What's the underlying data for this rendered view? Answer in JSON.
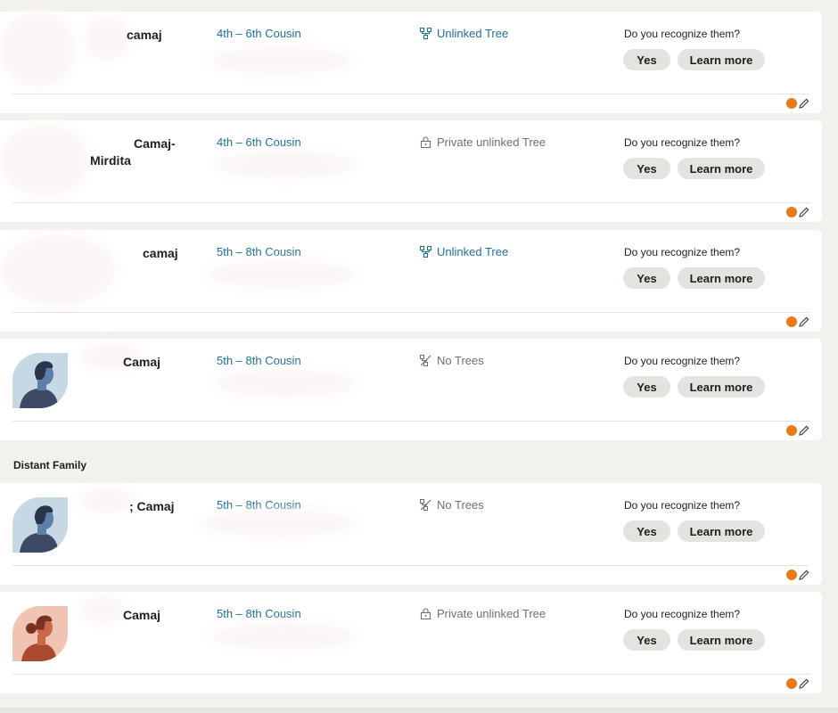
{
  "question": "Do you recognize them?",
  "yes_label": "Yes",
  "learn_more_label": "Learn more",
  "section_distant_family": "Distant Family",
  "colors": {
    "accent_orange": "#e87a17",
    "link_blue": "#1e6f9a",
    "button_bg": "#e4e3e0",
    "page_bg": "#f3f1ee"
  },
  "matches": [
    {
      "name": "camaj",
      "relationship": "4th – 6th Cousin",
      "tree": "Unlinked Tree",
      "tree_icon": "tree-icon",
      "avatar": "hidden"
    },
    {
      "name": "Camaj-\nMirdita",
      "relationship": "4th – 6th Cousin",
      "tree": "Private unlinked Tree",
      "tree_icon": "lock-icon",
      "avatar": "hidden"
    },
    {
      "name": "camaj",
      "relationship": "5th – 8th Cousin",
      "tree": "Unlinked Tree",
      "tree_icon": "tree-icon",
      "avatar": "hidden"
    },
    {
      "name": "Camaj",
      "relationship": "5th – 8th Cousin",
      "tree": "No Trees",
      "tree_icon": "no-tree-icon",
      "avatar": "male-silhouette"
    },
    {
      "name": "; Camaj",
      "relationship": "5th – 8th Cousin",
      "tree": "No Trees",
      "tree_icon": "no-tree-icon",
      "avatar": "male-silhouette"
    },
    {
      "name": "Camaj",
      "relationship": "5th – 8th Cousin",
      "tree": "Private unlinked Tree",
      "tree_icon": "lock-icon",
      "avatar": "female-silhouette"
    }
  ]
}
